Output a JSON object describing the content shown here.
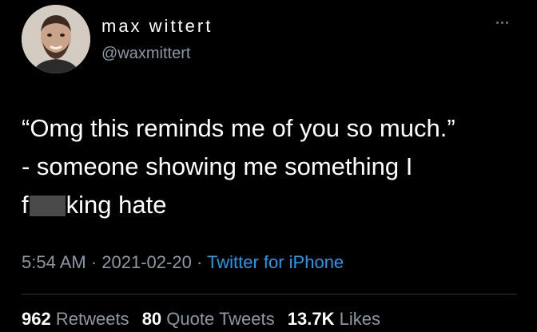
{
  "colors": {
    "background": "#000000",
    "text": "#ffffff",
    "secondary": "#8b98a5",
    "link": "#1d9bf0",
    "censor_bar": "#4a4a4a"
  },
  "author": {
    "display_name": "max wittert",
    "handle": "@waxmittert",
    "avatar_icon": "profile-photo"
  },
  "more_icon": "ellipsis-icon",
  "tweet": {
    "line1": "“Omg this reminds me of you so much.”",
    "line2": "- someone showing me something I",
    "line3_prefix": "f",
    "line3_suffix": "king hate"
  },
  "meta": {
    "time": "5:54 AM",
    "sep1": " · ",
    "date": "2021-02-20",
    "sep2": " · ",
    "source": "Twitter for iPhone"
  },
  "stats": {
    "retweets_count": "962",
    "retweets_label": "Retweets",
    "quotes_count": "80",
    "quotes_label": "Quote Tweets",
    "likes_count": "13.7K",
    "likes_label": "Likes"
  }
}
